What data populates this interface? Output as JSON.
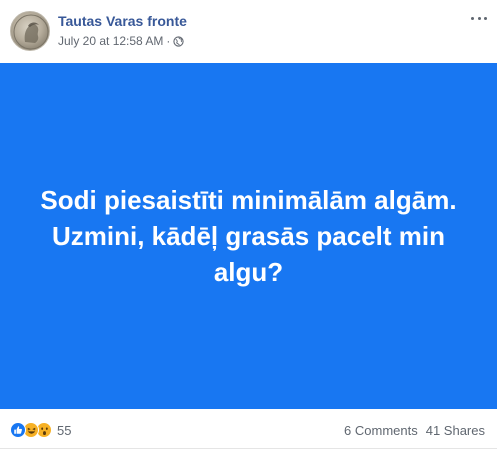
{
  "post": {
    "page_name": "Tautas Varas fronte",
    "timestamp": "July 20 at 12:58 AM",
    "separator": "·",
    "privacy_icon": "globe-icon",
    "more_icon": "more-options-icon",
    "background_color": "#1877f2",
    "text": "Sodi piesaistīti minimālām algām. Uzmini, kādēļ grasās pacelt min algu?"
  },
  "footer": {
    "reaction_icons": [
      "like-icon",
      "haha-icon",
      "wow-icon"
    ],
    "reaction_count": "55",
    "comments": "6 Comments",
    "shares": "41 Shares"
  }
}
